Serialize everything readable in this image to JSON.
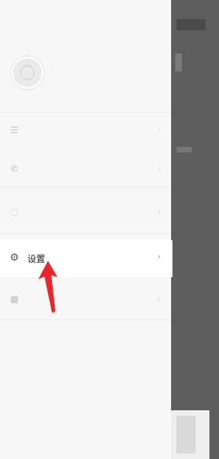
{
  "status_bar": {
    "left_text": "",
    "right_text": ""
  },
  "profile": {
    "name": "",
    "subtitle": ""
  },
  "menu": {
    "items": [
      {
        "label": "",
        "icon": "list-icon"
      },
      {
        "label": "",
        "icon": "phone-icon"
      },
      {
        "label": "",
        "icon": "chat-icon"
      },
      {
        "label": "设置",
        "icon": "gear-icon"
      },
      {
        "label": "",
        "icon": "grid-icon"
      }
    ]
  },
  "logout": {
    "label": ""
  },
  "annotation": {
    "color": "#e8262b"
  },
  "colors": {
    "drawer_bg": "#f7f7f7",
    "overlay": "#5f5f5f",
    "active_bg": "#ffffff"
  }
}
